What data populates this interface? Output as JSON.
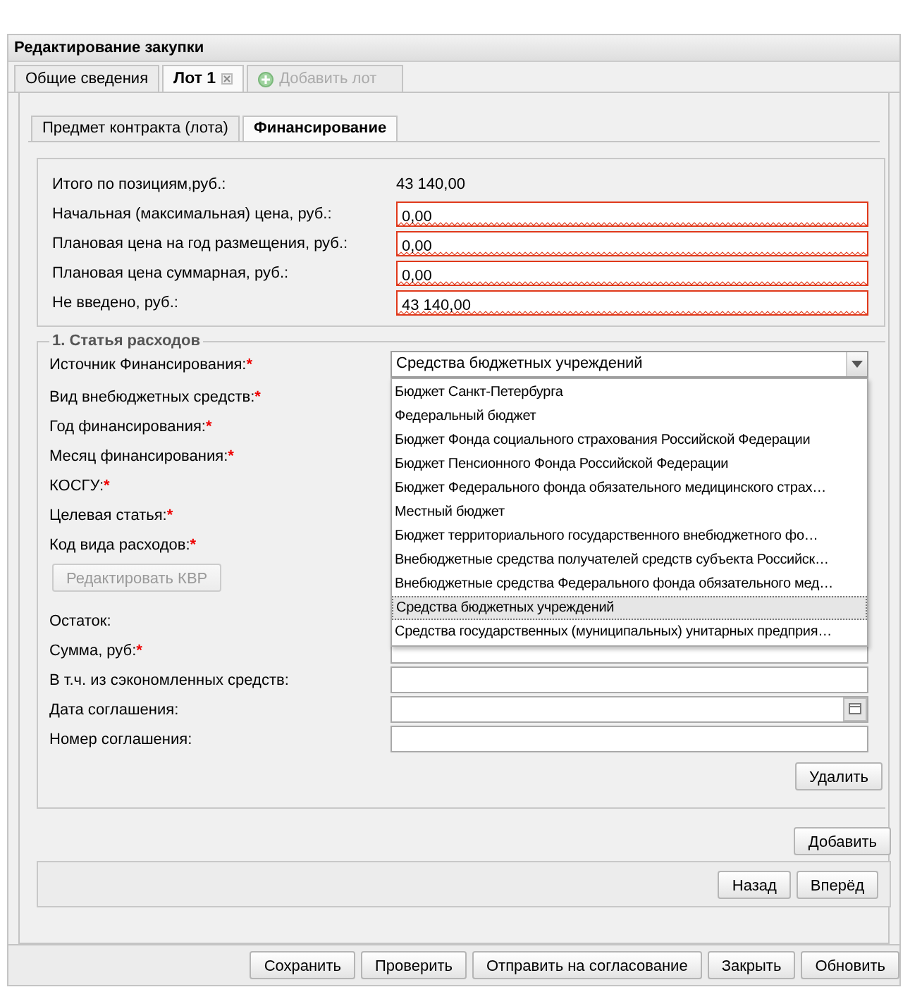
{
  "window": {
    "title": "Редактирование закупки"
  },
  "tabs": [
    {
      "label": "Общие сведения",
      "kind": "tab",
      "selected": false
    },
    {
      "label": "Лот 1",
      "kind": "closable",
      "selected": true
    },
    {
      "label": "Добавить лот",
      "kind": "add",
      "selected": false
    }
  ],
  "subtabs": [
    {
      "label": "Предмет контракта (лота)",
      "selected": false
    },
    {
      "label": "Финансирование",
      "selected": true
    }
  ],
  "summary": [
    {
      "label": "Итого по позициям,руб.:",
      "kind": "text",
      "value": "43 140,00"
    },
    {
      "label": "Начальная (максимальная) цена, руб.:",
      "kind": "field",
      "value": "0,00",
      "invalid": true
    },
    {
      "label": "Плановая цена на год размещения, руб.:",
      "kind": "field",
      "value": "0,00",
      "invalid": true
    },
    {
      "label": "Плановая цена суммарная, руб.:",
      "kind": "field",
      "value": "0,00",
      "invalid": true
    },
    {
      "label": "Не введено, руб.:",
      "kind": "field",
      "value": "43 140,00",
      "invalid": true
    }
  ],
  "expense_section": {
    "legend": "1. Статья расходов",
    "required_mark": "*",
    "rows": [
      {
        "label": "Источник Финансирования:",
        "required": true,
        "kind": "combo",
        "value": "Средства бюджетных учреждений",
        "expanded": true,
        "options": [
          {
            "label": "Бюджет Санкт-Петербурга",
            "selected": false
          },
          {
            "label": "Федеральный бюджет",
            "selected": false
          },
          {
            "label": "Бюджет Фонда социального страхования Российской Федерации",
            "selected": false
          },
          {
            "label": "Бюджет Пенсионного Фонда Российской Федерации",
            "selected": false
          },
          {
            "label": "Бюджет Федерального фонда обязательного медицинского страх…",
            "selected": false
          },
          {
            "label": "Местный бюджет",
            "selected": false
          },
          {
            "label": "Бюджет территориального государственного внебюджетного фо…",
            "selected": false
          },
          {
            "label": "Внебюджетные средства получателей средств субъекта Российск…",
            "selected": false
          },
          {
            "label": "Внебюджетные средства Федерального фонда обязательного мед…",
            "selected": false
          },
          {
            "label": "Средства бюджетных учреждений",
            "selected": true
          },
          {
            "label": "Средства государственных (муниципальных) унитарных предприя…",
            "selected": false
          }
        ]
      },
      {
        "label": "Вид внебюджетных средств:",
        "required": true,
        "kind": "label"
      },
      {
        "label": "Год финансирования:",
        "required": true,
        "kind": "label"
      },
      {
        "label": "Месяц финансирования:",
        "required": true,
        "kind": "label"
      },
      {
        "label": "КОСГУ:",
        "required": true,
        "kind": "label"
      },
      {
        "label": "Целевая статья:",
        "required": true,
        "kind": "label"
      },
      {
        "label": "Код вида расходов:",
        "required": true,
        "kind": "label"
      },
      {
        "label": "Редактировать КВР",
        "kind": "button",
        "disabled": true
      },
      {
        "label": "Остаток:",
        "required": false,
        "kind": "label"
      },
      {
        "label": "Сумма, руб:",
        "required": true,
        "kind": "field"
      },
      {
        "label": "В т.ч. из сэкономленных средств:",
        "required": false,
        "kind": "field"
      },
      {
        "label": "Дата соглашения:",
        "required": false,
        "kind": "date"
      },
      {
        "label": "Номер соглашения:",
        "required": false,
        "kind": "field"
      }
    ],
    "delete_button": "Удалить"
  },
  "add_button": "Добавить",
  "nav_buttons": [
    "Назад",
    "Вперёд"
  ],
  "footer_buttons": [
    "Сохранить",
    "Проверить",
    "Отправить на согласование",
    "Закрыть",
    "Обновить"
  ]
}
